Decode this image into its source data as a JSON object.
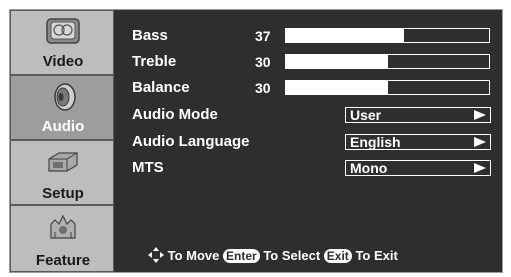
{
  "sidebar": {
    "items": [
      {
        "label": "Video",
        "icon": "video-icon"
      },
      {
        "label": "Audio",
        "icon": "speaker-icon"
      },
      {
        "label": "Setup",
        "icon": "setup-icon"
      },
      {
        "label": "Feature",
        "icon": "feature-icon"
      }
    ],
    "active_index": 1
  },
  "audio": {
    "bass": {
      "label": "Bass",
      "value": "37",
      "level": 0.58
    },
    "treble": {
      "label": "Treble",
      "value": "30",
      "level": 0.5
    },
    "balance": {
      "label": "Balance",
      "value": "30",
      "level": 0.5
    },
    "audio_mode": {
      "label": "Audio Mode",
      "value": "User"
    },
    "audio_language": {
      "label": "Audio Language",
      "value": "English"
    },
    "mts": {
      "label": "MTS",
      "value": "Mono"
    }
  },
  "hint": {
    "move": "To Move",
    "enter_key": "Enter",
    "select": "To Select",
    "exit_key": "Exit",
    "exit": "To Exit"
  },
  "colors": {
    "panel": "#2e2e2e",
    "tab": "#bdbdbd",
    "tab_active": "#9d9d9d",
    "text": "#ffffff"
  }
}
